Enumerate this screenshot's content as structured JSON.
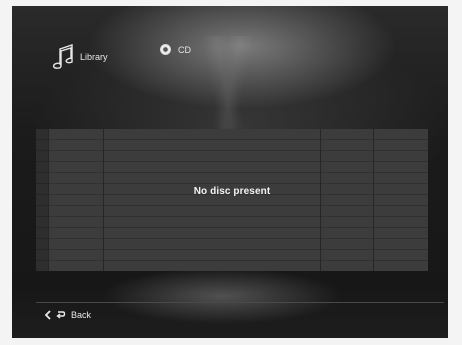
{
  "nav": {
    "library": {
      "label": "Library",
      "icon": "music-note-icon"
    },
    "cd": {
      "label": "CD",
      "icon": "cd-disc-icon"
    }
  },
  "table": {
    "empty_message": "No disc present"
  },
  "footer": {
    "back_label": "Back",
    "icons": [
      "chevron-left-icon",
      "return-arrow-icon"
    ]
  }
}
